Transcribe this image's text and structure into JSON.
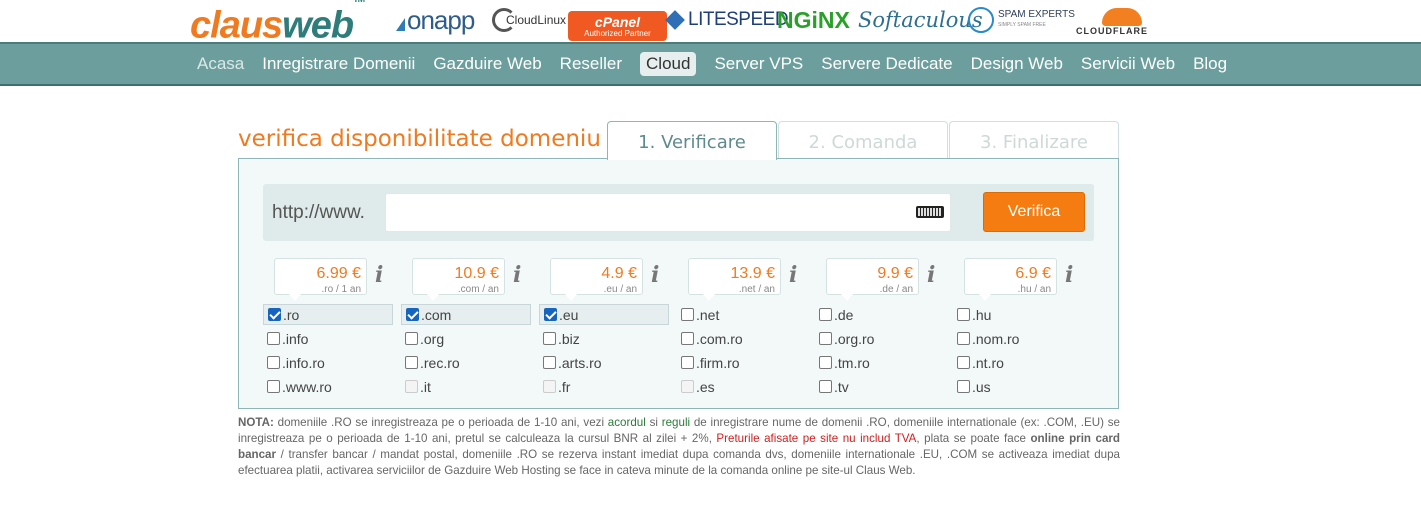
{
  "brand": {
    "part1": "claus",
    "part2": "web",
    "tm": "TM"
  },
  "partners": {
    "onapp": "onapp",
    "cloudlinux": "CloudLinux",
    "cpanel_name": "cPanel",
    "cpanel_sub": "Authorized Partner",
    "litespeed": "LITESPEED",
    "nginx": "NGiNX",
    "softaculous": "Softaculous",
    "spamexperts": "SPAM EXPERTS",
    "spamexperts_sub": "SIMPLY SPAM FREE",
    "cloudflare": "CLOUDFLARE"
  },
  "nav": {
    "items": [
      "Acasa",
      "Inregistrare Domenii",
      "Gazduire Web",
      "Reseller",
      "Cloud",
      "Server VPS",
      "Servere Dedicate",
      "Design Web",
      "Servicii Web",
      "Blog"
    ],
    "active": "Acasa",
    "highlighted": "Cloud"
  },
  "domain_check": {
    "heading": "verifica disponibilitate domeniu ::",
    "tabs": [
      "1. Verificare",
      "2. Comanda",
      "3. Finalizare"
    ],
    "active_tab": "1. Verificare",
    "prefix": "http://www.",
    "input_value": "",
    "button": "Verifica",
    "prices": [
      {
        "amount": "6.99 €",
        "period": ".ro / 1 an"
      },
      {
        "amount": "10.9 €",
        "period": ".com / an"
      },
      {
        "amount": "4.9 €",
        "period": ".eu / an"
      },
      {
        "amount": "13.9 €",
        "period": ".net / an"
      },
      {
        "amount": "9.9 €",
        "period": ".de / an"
      },
      {
        "amount": "6.9 €",
        "period": ".hu / an"
      }
    ],
    "info_glyph": "i",
    "extensions": [
      [
        {
          "label": ".ro",
          "checked": true
        },
        {
          "label": ".info",
          "checked": false
        },
        {
          "label": ".info.ro",
          "checked": false
        },
        {
          "label": ".www.ro",
          "checked": false
        }
      ],
      [
        {
          "label": ".com",
          "checked": true
        },
        {
          "label": ".org",
          "checked": false
        },
        {
          "label": ".rec.ro",
          "checked": false
        },
        {
          "label": ".it",
          "checked": false,
          "disabled": true
        }
      ],
      [
        {
          "label": ".eu",
          "checked": true
        },
        {
          "label": ".biz",
          "checked": false
        },
        {
          "label": ".arts.ro",
          "checked": false
        },
        {
          "label": ".fr",
          "checked": false,
          "disabled": true
        }
      ],
      [
        {
          "label": ".net",
          "checked": false
        },
        {
          "label": ".com.ro",
          "checked": false
        },
        {
          "label": ".firm.ro",
          "checked": false
        },
        {
          "label": ".es",
          "checked": false,
          "disabled": true
        }
      ],
      [
        {
          "label": ".de",
          "checked": false
        },
        {
          "label": ".org.ro",
          "checked": false
        },
        {
          "label": ".tm.ro",
          "checked": false
        },
        {
          "label": ".tv",
          "checked": false
        }
      ],
      [
        {
          "label": ".hu",
          "checked": false
        },
        {
          "label": ".nom.ro",
          "checked": false
        },
        {
          "label": ".nt.ro",
          "checked": false
        },
        {
          "label": ".us",
          "checked": false
        }
      ]
    ]
  },
  "note": {
    "label": "NOTA:",
    "t1": " domeniile .RO se inregistreaza pe o perioada de 1-10 ani, vezi ",
    "link1": "acordul",
    "t2": " si ",
    "link2": "reguli",
    "t3": " de inregistrare nume de domenii .RO, domeniile internationale (ex: .COM, .EU) se inregistreaza pe o perioada de 1-10 ani, pretul se calculeaza la cursul BNR al zilei + 2%, ",
    "red": "Preturile afisate pe site nu includ TVA",
    "t4": ", plata se poate face ",
    "bold": "online prin card bancar",
    "t5": " / transfer bancar / mandat postal, domeniile .RO se rezerva instant imediat dupa comanda dvs, domeniile internationale .EU, .COM se activeaza imediat dupa efectuarea platii, activarea serviciilor de Gazduire Web Hosting se face in cateva minute de la comanda online pe site-ul Claus Web."
  },
  "colors": {
    "accent": "#f07a1f",
    "nav_bg": "#6b9e9d",
    "button": "#f57c10",
    "checkbox": "#1565c0"
  }
}
